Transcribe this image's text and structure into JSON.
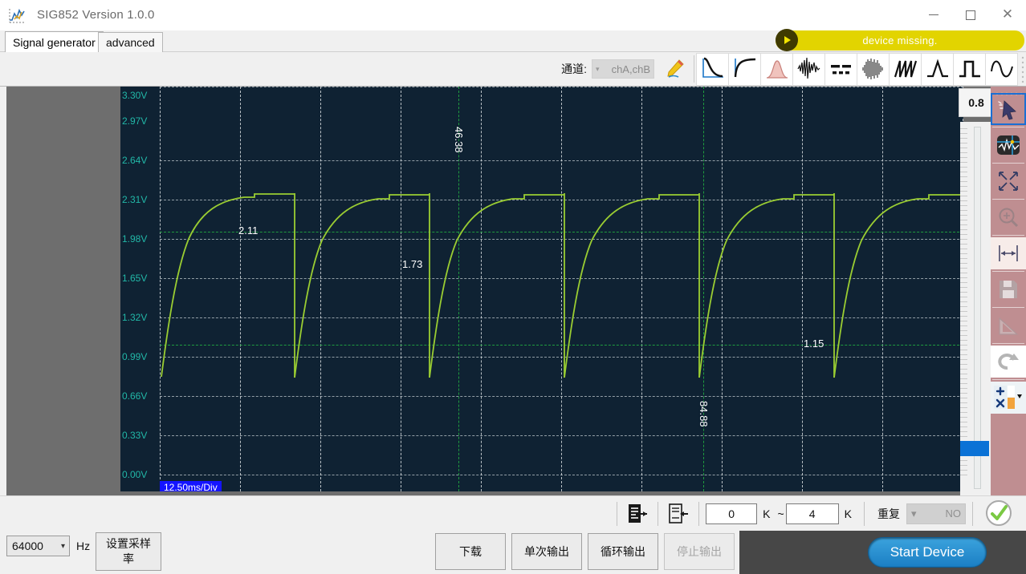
{
  "window": {
    "title": "SIG852  Version 1.0.0",
    "logo_icon": "waveform-logo-icon",
    "minimize_label": "",
    "maximize_label": "",
    "close_label": "✕"
  },
  "tabs": [
    {
      "label": "Signal generator",
      "active": true
    },
    {
      "label": "advanced",
      "active": false
    }
  ],
  "status": {
    "text": "device  missing.",
    "play_icon": "play-circle-icon",
    "color": "#e2d400"
  },
  "toolbar": {
    "channel_label": "通道:",
    "channel_value": "chA,chB",
    "channel_chevron": "▾",
    "icons": [
      {
        "name": "pencil-edit-icon",
        "title": "edit"
      },
      {
        "name": "exp-decay-wave-icon",
        "title": "exponential decay"
      },
      {
        "name": "exp-rise-wave-icon",
        "title": "exponential rise"
      },
      {
        "name": "gaussian-pulse-icon",
        "title": "gaussian"
      },
      {
        "name": "noise-wave-icon",
        "title": "noise"
      },
      {
        "name": "dc-dashed-icon",
        "title": "dc / dashed"
      },
      {
        "name": "am-burst-icon",
        "title": "modulated burst"
      },
      {
        "name": "sawtooth-wave-icon",
        "title": "sawtooth"
      },
      {
        "name": "triangle-wave-icon",
        "title": "triangle"
      },
      {
        "name": "square-wave-icon",
        "title": "square"
      },
      {
        "name": "sine-wave-icon",
        "title": "sine"
      }
    ]
  },
  "plot": {
    "value_badge": "0.8",
    "time_per_div": "12.50ms/Div",
    "y_ticks": [
      "3.30V",
      "2.97V",
      "2.64V",
      "2.31V",
      "1.98V",
      "1.65V",
      "1.32V",
      "0.99V",
      "0.66V",
      "0.33V",
      "0.00V"
    ],
    "cursors": {
      "horizontal": [
        {
          "label": "2.11",
          "value": 2.11
        },
        {
          "label": "1.15",
          "value": 1.15
        }
      ],
      "vertical": [
        {
          "label": "46.38",
          "value": 46.38
        },
        {
          "label": "84.88",
          "value": 84.88
        }
      ],
      "extra": [
        {
          "label": "1.73",
          "value": 1.73
        }
      ]
    }
  },
  "chart_data": {
    "type": "line",
    "title": "",
    "xlabel": "",
    "ylabel": "",
    "ylim": [
      0.0,
      3.3
    ],
    "ytick_values": [
      3.3,
      2.97,
      2.64,
      2.31,
      1.98,
      1.65,
      1.32,
      0.99,
      0.66,
      0.33,
      0.0
    ],
    "ytick_labels": [
      "3.30V",
      "2.97V",
      "2.64V",
      "2.31V",
      "1.98V",
      "1.65V",
      "1.32V",
      "0.99V",
      "0.66V",
      "0.33V",
      "0.00V"
    ],
    "grid": true,
    "legend": "none",
    "time_per_div": "12.50ms/Div",
    "divisions_x": 10,
    "series": [
      {
        "name": "chA",
        "color": "#9acd32",
        "description": "Repeating RC charge / discharge sawtooth. Each cycle rises exponentially from ~0.55V to a ~2.33V plateau then drops vertically back to ~0.55V.",
        "period_ms": 25.0,
        "v_min": 0.55,
        "v_max": 2.33,
        "cycles_visible": 6,
        "waveform_points_v": [
          0.55,
          1.2,
          1.65,
          1.92,
          2.08,
          2.18,
          2.25,
          2.29,
          2.31,
          2.33,
          2.33,
          2.33,
          2.33,
          2.33,
          0.55
        ]
      }
    ],
    "annotations": [
      {
        "text": "2.11",
        "type": "horizontal-cursor"
      },
      {
        "text": "1.15",
        "type": "horizontal-cursor"
      },
      {
        "text": "46.38",
        "type": "vertical-cursor"
      },
      {
        "text": "84.88",
        "type": "vertical-cursor"
      },
      {
        "text": "1.73",
        "type": "measurement"
      }
    ]
  },
  "rail": [
    {
      "name": "pointer-select-icon",
      "selected": true
    },
    {
      "name": "waveform-thumbnail-icon",
      "selected": false
    },
    {
      "name": "expand-arrows-icon",
      "selected": false
    },
    {
      "name": "zoom-in-icon",
      "selected": false
    },
    {
      "name": "horizontal-measure-icon",
      "selected": false
    },
    {
      "name": "save-disk-icon",
      "selected": false
    },
    {
      "name": "ruler-triangle-icon",
      "selected": false
    },
    {
      "name": "redo-arrow-icon",
      "selected": false
    },
    {
      "name": "add-remove-icon",
      "selected": false
    }
  ],
  "lowerbar": {
    "export_icon": "document-export-icon",
    "import_icon": "document-import-icon",
    "range_from": "0",
    "range_from_unit": "K",
    "range_sep": "~",
    "range_to": "4",
    "range_to_unit": "K",
    "repeat_label": "重复",
    "repeat_value": "NO",
    "repeat_chevron": "▾",
    "confirm_icon": "check-circle-icon"
  },
  "bottombar": {
    "sample_rate_value": "64000",
    "sample_rate_chevron": "▾",
    "hz_label": "Hz",
    "set_sample_rate_label": "设置采样率",
    "download_label": "下载",
    "single_output_label": "单次输出",
    "loop_output_label": "循环输出",
    "stop_output_label": "停止输出",
    "start_device_label": "Start Device"
  }
}
